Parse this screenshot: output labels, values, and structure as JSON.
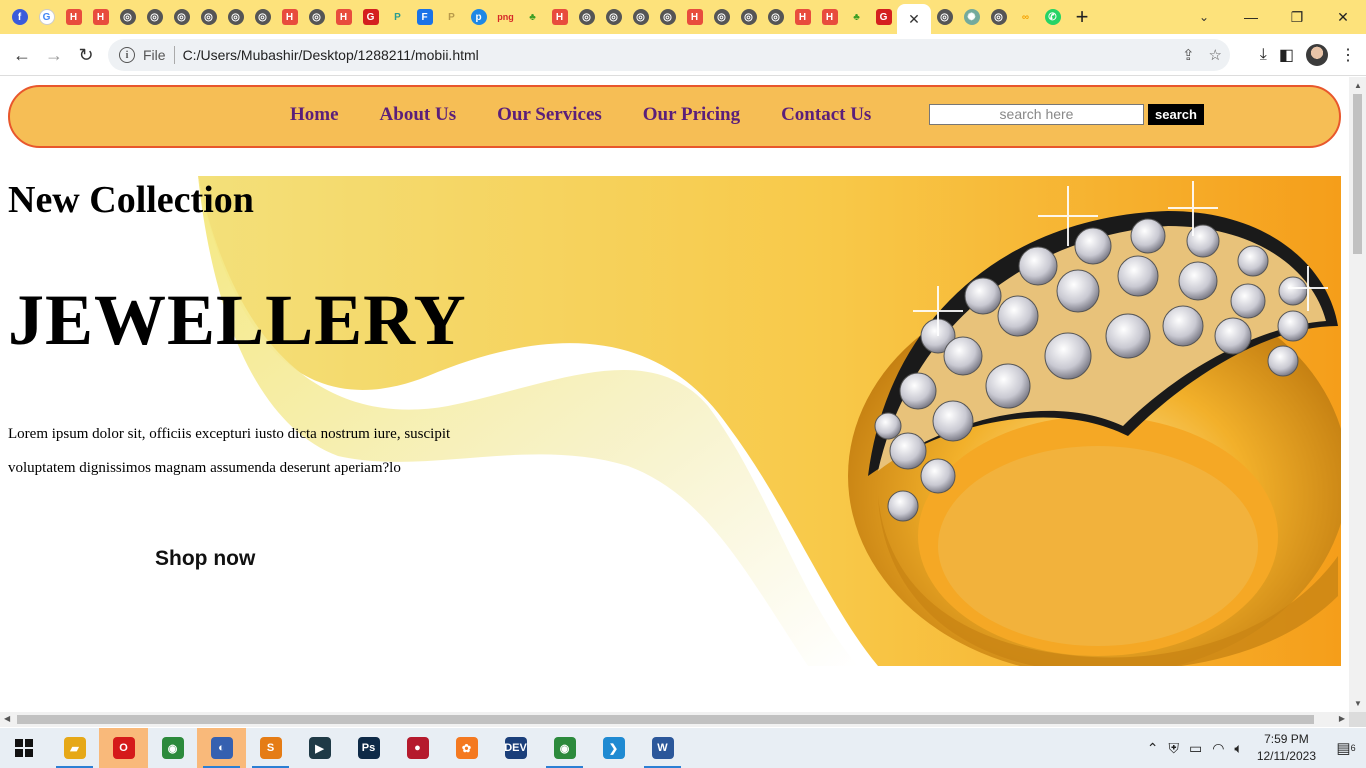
{
  "browser": {
    "address": "C:/Users/Mubashir/Desktop/1288211/mobii.html",
    "scheme_label": "File",
    "active_tab_close": "✕",
    "new_tab": "+"
  },
  "site": {
    "nav": [
      "Home",
      "About Us",
      "Our Services",
      "Our Pricing",
      "Contact Us"
    ],
    "search_placeholder": "search here",
    "search_button": "search"
  },
  "hero": {
    "title_small": "New Collection",
    "title_big": "JEWELLERY",
    "text": "Lorem ipsum dolor sit, officiis excepturi iusto dicta nostrum iure, suscipit voluptatem dignissimos magnam assumenda deserunt aperiam?lo",
    "cta": "Shop now",
    "colors": {
      "gold": "#f7a21b",
      "light": "#f5f3c8",
      "band": "#f3dd6e"
    }
  },
  "taskbar": {
    "apps": [
      {
        "name": "file-explorer",
        "glyph": "▰",
        "color": "#e6a817",
        "highlight": false,
        "running": true
      },
      {
        "name": "opera",
        "glyph": "O",
        "color": "#d51a1a",
        "highlight": true,
        "running": false
      },
      {
        "name": "chrome",
        "glyph": "◉",
        "color": "#2c8a3c",
        "highlight": false,
        "running": false
      },
      {
        "name": "media-player",
        "glyph": "◐",
        "color": "#3560b0",
        "highlight": true,
        "running": true
      },
      {
        "name": "sublime-text",
        "glyph": "S",
        "color": "#e57c15",
        "highlight": false,
        "running": true
      },
      {
        "name": "terminal",
        "glyph": "▶",
        "color": "#1f3a46",
        "highlight": false,
        "running": false
      },
      {
        "name": "photoshop",
        "glyph": "Ps",
        "color": "#0e2a47",
        "highlight": false,
        "running": false
      },
      {
        "name": "recorder",
        "glyph": "●",
        "color": "#b51a2d",
        "highlight": false,
        "running": false
      },
      {
        "name": "xampp",
        "glyph": "✿",
        "color": "#f47920",
        "highlight": false,
        "running": false
      },
      {
        "name": "dev-cpp",
        "glyph": "DEV",
        "color": "#1b3f7a",
        "highlight": false,
        "running": false
      },
      {
        "name": "chrome-profile",
        "glyph": "◉",
        "color": "#2c8a3c",
        "highlight": false,
        "running": true
      },
      {
        "name": "vscode",
        "glyph": "❯",
        "color": "#1f8ad2",
        "highlight": false,
        "running": false
      },
      {
        "name": "word",
        "glyph": "W",
        "color": "#2b579a",
        "highlight": false,
        "running": true
      }
    ],
    "time": "7:59 PM",
    "date": "12/11/2023",
    "notifications": "6"
  }
}
